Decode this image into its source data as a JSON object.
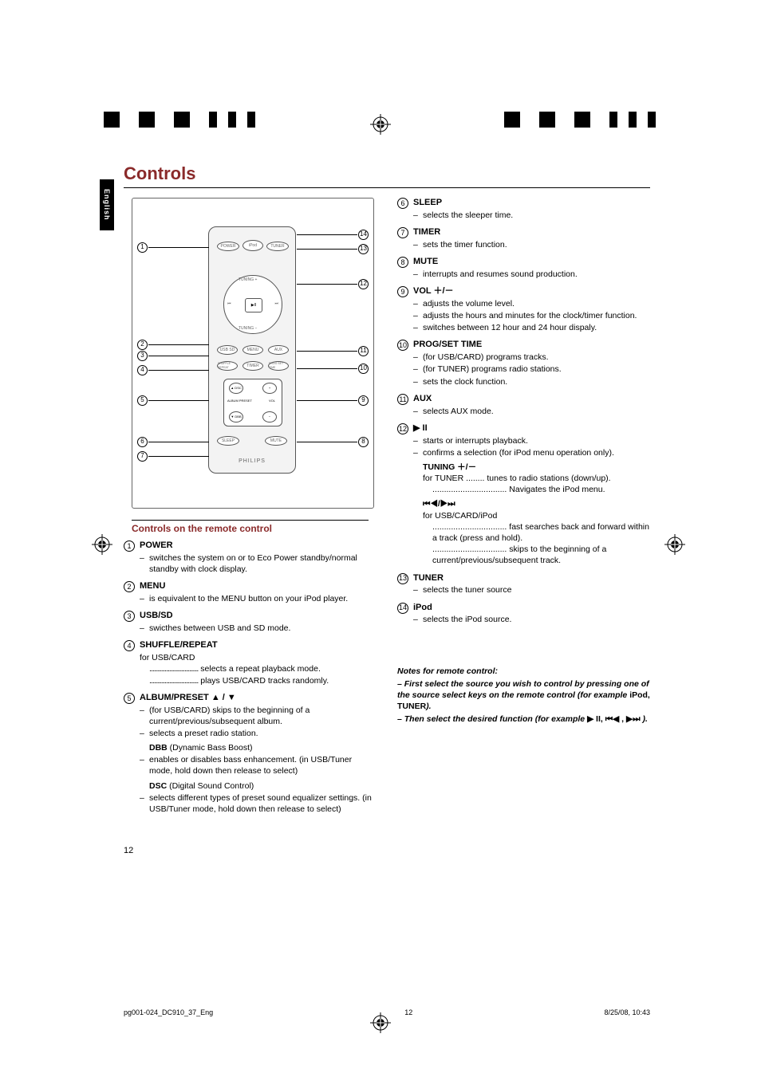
{
  "lang_tab": "English",
  "title": "Controls",
  "subhead": "Controls on the remote control",
  "diagram": {
    "brand": "PHILIPS",
    "top_buttons": [
      "POWER",
      "iPod",
      "TUNER"
    ],
    "dpad": {
      "center": "▶II",
      "up": "TUNING +",
      "down": "TUNING −",
      "left": "⏮",
      "right": "⏭"
    },
    "mid_buttons": [
      [
        "USB SD",
        "MENU",
        "AUX"
      ],
      [
        "SHUFFLE REPEAT",
        "TIMER",
        "PROG SET TIME"
      ]
    ],
    "block_rows": [
      [
        "▲ DSC",
        "+"
      ],
      [
        "ALBUM PRESET",
        "VOL"
      ],
      [
        "▼ DBB",
        "−"
      ]
    ],
    "bottom_buttons": [
      "SLEEP",
      "MUTE"
    ]
  },
  "callouts_left": [
    "1",
    "2",
    "3",
    "4",
    "5",
    "6",
    "7"
  ],
  "callouts_right": [
    "14",
    "13",
    "12",
    "11",
    "10",
    "9",
    "8"
  ],
  "items_left": [
    {
      "num": "1",
      "name": "POWER",
      "descs": [
        "switches the system on or to Eco Power standby/normal standby with clock display."
      ]
    },
    {
      "num": "2",
      "name": "MENU",
      "descs": [
        "is equivalent to the MENU button on your iPod player."
      ]
    },
    {
      "num": "3",
      "name": "USB/SD",
      "descs": [
        "swicthes between USB and SD mode."
      ]
    },
    {
      "num": "4",
      "name": "SHUFFLE/REPEAT",
      "pre": "for USB/CARD",
      "subs": [
        {
          "dots": "................................",
          "text": "selects a repeat playback mode."
        },
        {
          "dots": "................................",
          "text": "plays USB/CARD tracks randomly."
        }
      ]
    },
    {
      "num": "5",
      "name": "ALBUM/PRESET ▲ / ▼",
      "descs": [
        "(for USB/CARD) skips to the beginning of a current/previous/subsequent album.",
        "selects a preset radio station."
      ],
      "extras": [
        {
          "bold": "DBB",
          "tail": " (Dynamic Bass Boost)",
          "desc": "enables or disables bass enhancement. (in USB/Tuner mode, hold down then release to select)"
        },
        {
          "bold": "DSC",
          "tail": " (Digital Sound Control)",
          "desc": "selects different types of preset sound equalizer settings. (in USB/Tuner mode, hold down then release to select)"
        }
      ]
    }
  ],
  "items_right": [
    {
      "num": "6",
      "name": "SLEEP",
      "descs": [
        "selects the sleeper time."
      ]
    },
    {
      "num": "7",
      "name": "TIMER",
      "descs": [
        "sets the timer function."
      ]
    },
    {
      "num": "8",
      "name": "MUTE",
      "descs": [
        "interrupts and resumes sound production."
      ]
    },
    {
      "num": "9",
      "name": "VOL ＋/－",
      "descs": [
        "adjusts the volume level.",
        "adjusts the hours and minutes for the clock/timer function.",
        "switches between 12 hour and 24 hour dispaly."
      ]
    },
    {
      "num": "10",
      "name": "PROG/SET TIME",
      "descs": [
        "(for USB/CARD) programs tracks.",
        "(for TUNER) programs radio stations.",
        "sets the clock function."
      ]
    },
    {
      "num": "11",
      "name": "AUX",
      "descs": [
        "selects AUX mode."
      ]
    },
    {
      "num": "12",
      "name": "▶ II",
      "descs": [
        "starts or interrupts playback.",
        "confirms a selection (for iPod menu operation only)."
      ],
      "tuning": {
        "title": "TUNING ＋/－",
        "lead": "for TUNER",
        "dots1": "........",
        "text1": "tunes to radio stations (down/up).",
        "dots2": "................................",
        "text2": "Navigates the iPod menu."
      },
      "nav": {
        "title": "⏮◀/▶⏭",
        "lead": "for USB/CARD/iPod",
        "rows": [
          {
            "dots": "................................",
            "text": "fast searches back and forward within a track (press and hold)."
          },
          {
            "dots": "................................",
            "text": "skips to the beginning of a current/previous/subsequent track."
          }
        ]
      }
    },
    {
      "num": "13",
      "name": "TUNER",
      "descs": [
        "selects the tuner source"
      ]
    },
    {
      "num": "14",
      "name": "iPod",
      "descs": [
        "selects the iPod source."
      ]
    }
  ],
  "notes": {
    "heading": "Notes for remote control:",
    "line1_pre": "–  First select the source you wish to control by pressing one of the source select keys on the remote control (for example ",
    "line1_bold": "iPod, TUNER",
    "line1_post": ").",
    "line2_pre": "–  Then select the desired function (for example  ",
    "line2_sym": "▶ II,  ⏮◀ , ▶⏭",
    "line2_post": "  )."
  },
  "page_number": "12",
  "footer_left": "pg001-024_DC910_37_Eng",
  "footer_mid": "12",
  "footer_right": "8/25/08, 10:43"
}
